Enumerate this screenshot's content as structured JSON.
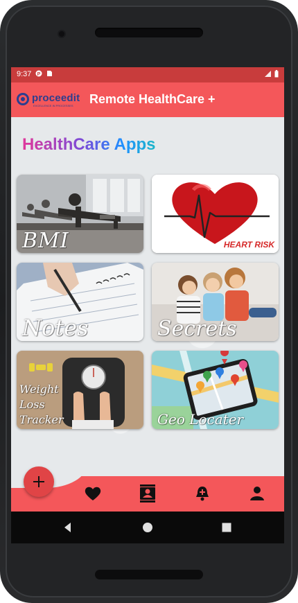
{
  "status_bar": {
    "time": "9:37"
  },
  "app_bar": {
    "logo_text": "proceedit",
    "logo_sub": "EXCELLENCE IN PROCESSES",
    "title": "Remote HealthCare +"
  },
  "section_title": "HealthCare Apps",
  "cards": [
    {
      "label": "BMI"
    },
    {
      "label": "HEART RISK"
    },
    {
      "label": "Notes"
    },
    {
      "label": "Secrets"
    },
    {
      "label": "Weight Loss Tracker"
    },
    {
      "label": "Geo Locater"
    }
  ],
  "bottom_nav": {
    "fab_icon": "plus-icon",
    "items": [
      {
        "icon": "heart-icon"
      },
      {
        "icon": "contacts-book-icon"
      },
      {
        "icon": "bell-plus-icon"
      },
      {
        "icon": "person-icon"
      }
    ]
  },
  "colors": {
    "primary": "#f4575a",
    "status_bar": "#c83c3c",
    "title_gradient": [
      "#e0389b",
      "#7a4ad8",
      "#1e90ff",
      "#1cb6c8"
    ]
  }
}
